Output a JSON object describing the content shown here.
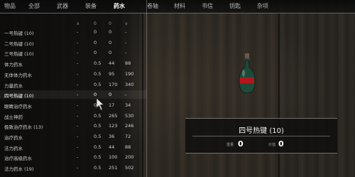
{
  "tabs": [
    {
      "label": "物品"
    },
    {
      "label": "全部"
    },
    {
      "label": "武器"
    },
    {
      "label": "装备"
    },
    {
      "label": "药水",
      "active": true
    },
    {
      "label": "卷轴"
    },
    {
      "label": "材料"
    },
    {
      "label": "书信"
    },
    {
      "label": "钥匙"
    },
    {
      "label": "杂项"
    }
  ],
  "list_header": {
    "col_x": "x",
    "col_a": "0",
    "col_b": "0",
    "col_c": "v"
  },
  "items": [
    {
      "name": "一号热键 (10)",
      "dash": "-",
      "c1": "0",
      "c2": "0",
      "c3": "-"
    },
    {
      "name": "二号热键 (10)",
      "dash": "-",
      "c1": "0",
      "c2": "0",
      "c3": "-"
    },
    {
      "name": "三号热键 (10)",
      "dash": "-",
      "c1": "0",
      "c2": "0",
      "c3": "-"
    },
    {
      "name": "体力药水",
      "dash": "-",
      "c1": "0.5",
      "c2": "44",
      "c3": "88"
    },
    {
      "name": "无体体力药水",
      "dash": "-",
      "c1": "0.5",
      "c2": "95",
      "c3": "190"
    },
    {
      "name": "力量药水",
      "dash": "-",
      "c1": "0.5",
      "c2": "170",
      "c3": "340"
    },
    {
      "name": "四号热键 (10)",
      "dash": "-",
      "c1": "0",
      "c2": "0",
      "c3": "-",
      "selected": true
    },
    {
      "name": "眼睛治疗药水",
      "dash": "-",
      "c1": "0.5",
      "c2": "17",
      "c3": "34"
    },
    {
      "name": "战士神药",
      "dash": "-",
      "c1": "0.5",
      "c2": "265",
      "c3": "530"
    },
    {
      "name": "极致治疗药水 (13)",
      "dash": "-",
      "c1": "0.5",
      "c2": "123",
      "c3": "246"
    },
    {
      "name": "治疗药水",
      "dash": "-",
      "c1": "0.5",
      "c2": "36",
      "c3": "72"
    },
    {
      "name": "法力药水",
      "dash": "-",
      "c1": "0.5",
      "c2": "44",
      "c3": "88"
    },
    {
      "name": "治疗高级药水",
      "dash": "-",
      "c1": "0.5",
      "c2": "100",
      "c3": "200"
    },
    {
      "name": "法力药水 (19)",
      "dash": "-",
      "c1": "0.5",
      "c2": "251",
      "c3": "502"
    }
  ],
  "detail": {
    "title": "四号热键 (10)",
    "stat1_label": "重量",
    "stat1_value": "0",
    "stat2_label": "价值",
    "stat2_value": "0"
  },
  "icons": {
    "item_preview": "potion-bottle-icon",
    "pointer": "mouse-cursor-icon"
  },
  "colors": {
    "bottle_glass": "#1f4a3a",
    "bottle_band": "#b3161a"
  }
}
